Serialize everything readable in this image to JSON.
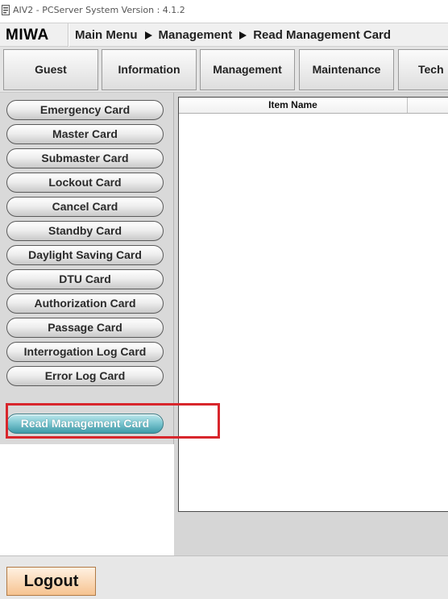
{
  "window": {
    "title": "AIV2 - PCServer System Version : 4.1.2"
  },
  "header": {
    "brand": "MIWA",
    "breadcrumb": [
      "Main Menu",
      "Management",
      "Read Management Card"
    ]
  },
  "tabs": [
    {
      "label": "Guest"
    },
    {
      "label": "Information"
    },
    {
      "label": "Management"
    },
    {
      "label": "Maintenance"
    },
    {
      "label": "Tech"
    }
  ],
  "sidebar": {
    "items": [
      {
        "label": "Emergency Card"
      },
      {
        "label": "Master Card"
      },
      {
        "label": "Submaster Card"
      },
      {
        "label": "Lockout Card"
      },
      {
        "label": "Cancel Card"
      },
      {
        "label": "Standby Card"
      },
      {
        "label": "Daylight Saving Card"
      },
      {
        "label": "DTU Card"
      },
      {
        "label": "Authorization Card"
      },
      {
        "label": "Passage Card"
      },
      {
        "label": "Interrogation Log Card"
      },
      {
        "label": "Error Log Card"
      }
    ],
    "active_item": {
      "label": "Read Management Card",
      "selected": true
    }
  },
  "table": {
    "columns": [
      "Item Name",
      ""
    ],
    "rows": []
  },
  "footer": {
    "logout_label": "Logout"
  },
  "colors": {
    "active_button": "#5fb3bf",
    "highlight": "#d8262c",
    "logout_button": "#f6c390"
  }
}
